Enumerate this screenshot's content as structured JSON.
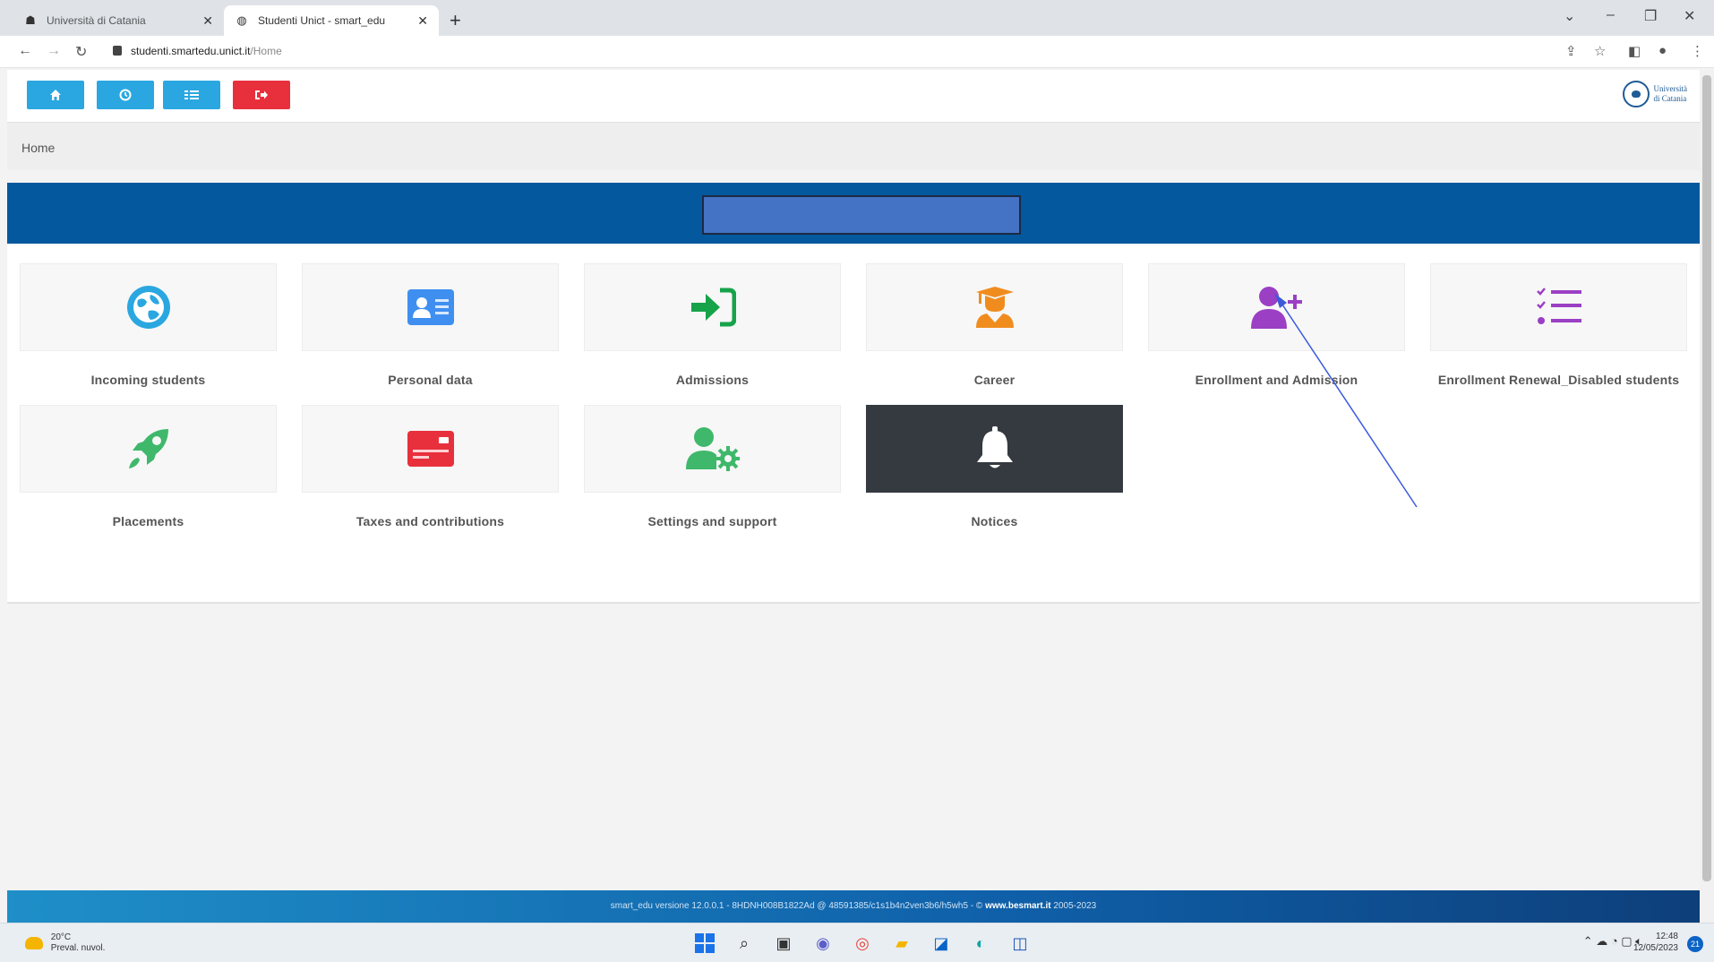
{
  "browser": {
    "tabs": [
      {
        "title": "Università di Catania"
      },
      {
        "title": "Studenti Unict - smart_edu"
      }
    ],
    "url_host": "studenti.smartedu.unict.it",
    "url_path": "/Home"
  },
  "header": {
    "logo_text_line1": "Università",
    "logo_text_line2": "di Catania"
  },
  "breadcrumb": {
    "current": "Home"
  },
  "tiles": [
    {
      "label": "Incoming students",
      "icon": "globe-icon",
      "color": "#2aa7e0"
    },
    {
      "label": "Personal data",
      "icon": "id-card-icon",
      "color": "#3f8ff0"
    },
    {
      "label": "Admissions",
      "icon": "sign-in-icon",
      "color": "#16a34a"
    },
    {
      "label": "Career",
      "icon": "graduate-icon",
      "color": "#f08c1e"
    },
    {
      "label": "Enrollment and Admission",
      "icon": "user-plus-icon",
      "color": "#9b3fc4"
    },
    {
      "label": "Enrollment Renewal_Disabled students",
      "icon": "checklist-icon",
      "color": "#9b3fc4"
    },
    {
      "label": "Placements",
      "icon": "rocket-icon",
      "color": "#3fb86b"
    },
    {
      "label": "Taxes and contributions",
      "icon": "credit-card-icon",
      "color": "#e8303d"
    },
    {
      "label": "Settings and support",
      "icon": "user-cog-icon",
      "color": "#3fb86b"
    },
    {
      "label": "Notices",
      "icon": "bell-icon",
      "color": "#ffffff"
    }
  ],
  "footer": {
    "version_text": "smart_edu versione 12.0.0.1 - 8HDNH008B1822Ad @ 48591385/c1s1b4n2ven3b6/h5wh5 - © ",
    "brand": "www.besmart.it",
    "years": " 2005-2023"
  },
  "taskbar": {
    "temperature": "20°C",
    "weather_desc": "Preval. nuvol.",
    "time": "12:48",
    "date": "12/05/2023",
    "notifications": "21"
  },
  "colors": {
    "banner": "#04589e",
    "primary_button": "#2aa7e0",
    "logout_button": "#e8303d",
    "footer": "#0f5fa8"
  }
}
